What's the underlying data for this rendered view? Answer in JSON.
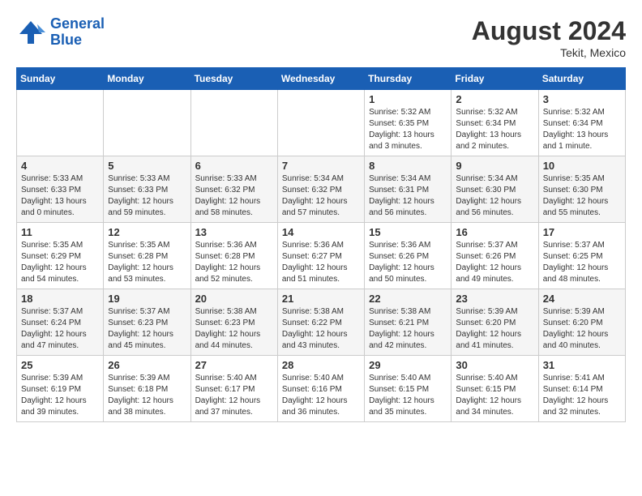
{
  "header": {
    "logo_line1": "General",
    "logo_line2": "Blue",
    "month_year": "August 2024",
    "location": "Tekit, Mexico"
  },
  "days_of_week": [
    "Sunday",
    "Monday",
    "Tuesday",
    "Wednesday",
    "Thursday",
    "Friday",
    "Saturday"
  ],
  "weeks": [
    [
      {
        "day": "",
        "info": ""
      },
      {
        "day": "",
        "info": ""
      },
      {
        "day": "",
        "info": ""
      },
      {
        "day": "",
        "info": ""
      },
      {
        "day": "1",
        "info": "Sunrise: 5:32 AM\nSunset: 6:35 PM\nDaylight: 13 hours\nand 3 minutes."
      },
      {
        "day": "2",
        "info": "Sunrise: 5:32 AM\nSunset: 6:34 PM\nDaylight: 13 hours\nand 2 minutes."
      },
      {
        "day": "3",
        "info": "Sunrise: 5:32 AM\nSunset: 6:34 PM\nDaylight: 13 hours\nand 1 minute."
      }
    ],
    [
      {
        "day": "4",
        "info": "Sunrise: 5:33 AM\nSunset: 6:33 PM\nDaylight: 13 hours\nand 0 minutes."
      },
      {
        "day": "5",
        "info": "Sunrise: 5:33 AM\nSunset: 6:33 PM\nDaylight: 12 hours\nand 59 minutes."
      },
      {
        "day": "6",
        "info": "Sunrise: 5:33 AM\nSunset: 6:32 PM\nDaylight: 12 hours\nand 58 minutes."
      },
      {
        "day": "7",
        "info": "Sunrise: 5:34 AM\nSunset: 6:32 PM\nDaylight: 12 hours\nand 57 minutes."
      },
      {
        "day": "8",
        "info": "Sunrise: 5:34 AM\nSunset: 6:31 PM\nDaylight: 12 hours\nand 56 minutes."
      },
      {
        "day": "9",
        "info": "Sunrise: 5:34 AM\nSunset: 6:30 PM\nDaylight: 12 hours\nand 56 minutes."
      },
      {
        "day": "10",
        "info": "Sunrise: 5:35 AM\nSunset: 6:30 PM\nDaylight: 12 hours\nand 55 minutes."
      }
    ],
    [
      {
        "day": "11",
        "info": "Sunrise: 5:35 AM\nSunset: 6:29 PM\nDaylight: 12 hours\nand 54 minutes."
      },
      {
        "day": "12",
        "info": "Sunrise: 5:35 AM\nSunset: 6:28 PM\nDaylight: 12 hours\nand 53 minutes."
      },
      {
        "day": "13",
        "info": "Sunrise: 5:36 AM\nSunset: 6:28 PM\nDaylight: 12 hours\nand 52 minutes."
      },
      {
        "day": "14",
        "info": "Sunrise: 5:36 AM\nSunset: 6:27 PM\nDaylight: 12 hours\nand 51 minutes."
      },
      {
        "day": "15",
        "info": "Sunrise: 5:36 AM\nSunset: 6:26 PM\nDaylight: 12 hours\nand 50 minutes."
      },
      {
        "day": "16",
        "info": "Sunrise: 5:37 AM\nSunset: 6:26 PM\nDaylight: 12 hours\nand 49 minutes."
      },
      {
        "day": "17",
        "info": "Sunrise: 5:37 AM\nSunset: 6:25 PM\nDaylight: 12 hours\nand 48 minutes."
      }
    ],
    [
      {
        "day": "18",
        "info": "Sunrise: 5:37 AM\nSunset: 6:24 PM\nDaylight: 12 hours\nand 47 minutes."
      },
      {
        "day": "19",
        "info": "Sunrise: 5:37 AM\nSunset: 6:23 PM\nDaylight: 12 hours\nand 45 minutes."
      },
      {
        "day": "20",
        "info": "Sunrise: 5:38 AM\nSunset: 6:23 PM\nDaylight: 12 hours\nand 44 minutes."
      },
      {
        "day": "21",
        "info": "Sunrise: 5:38 AM\nSunset: 6:22 PM\nDaylight: 12 hours\nand 43 minutes."
      },
      {
        "day": "22",
        "info": "Sunrise: 5:38 AM\nSunset: 6:21 PM\nDaylight: 12 hours\nand 42 minutes."
      },
      {
        "day": "23",
        "info": "Sunrise: 5:39 AM\nSunset: 6:20 PM\nDaylight: 12 hours\nand 41 minutes."
      },
      {
        "day": "24",
        "info": "Sunrise: 5:39 AM\nSunset: 6:20 PM\nDaylight: 12 hours\nand 40 minutes."
      }
    ],
    [
      {
        "day": "25",
        "info": "Sunrise: 5:39 AM\nSunset: 6:19 PM\nDaylight: 12 hours\nand 39 minutes."
      },
      {
        "day": "26",
        "info": "Sunrise: 5:39 AM\nSunset: 6:18 PM\nDaylight: 12 hours\nand 38 minutes."
      },
      {
        "day": "27",
        "info": "Sunrise: 5:40 AM\nSunset: 6:17 PM\nDaylight: 12 hours\nand 37 minutes."
      },
      {
        "day": "28",
        "info": "Sunrise: 5:40 AM\nSunset: 6:16 PM\nDaylight: 12 hours\nand 36 minutes."
      },
      {
        "day": "29",
        "info": "Sunrise: 5:40 AM\nSunset: 6:15 PM\nDaylight: 12 hours\nand 35 minutes."
      },
      {
        "day": "30",
        "info": "Sunrise: 5:40 AM\nSunset: 6:15 PM\nDaylight: 12 hours\nand 34 minutes."
      },
      {
        "day": "31",
        "info": "Sunrise: 5:41 AM\nSunset: 6:14 PM\nDaylight: 12 hours\nand 32 minutes."
      }
    ]
  ]
}
